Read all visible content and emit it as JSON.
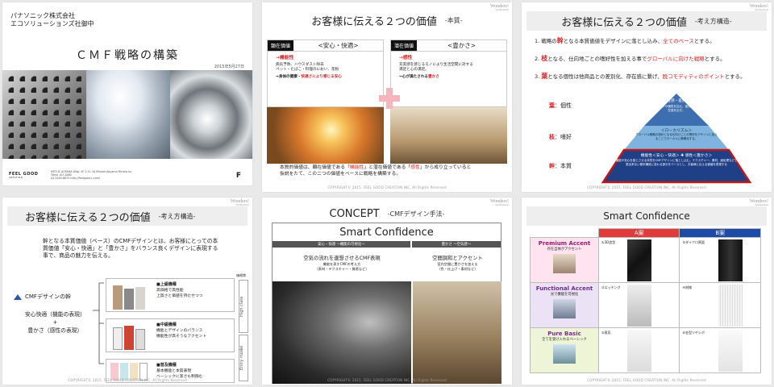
{
  "watermark": {
    "brand": "Wonders!",
    "tagline": "Synthesisnote"
  },
  "footer_copyright": "COPYRIGHT© 2015. FEEL GOOD CREATION INC. All Rights Reserved",
  "slide1": {
    "company": "パナソニック株式会社",
    "division": "エコソリューションズ社御中",
    "title": "ＣＭＦ戦略の構築",
    "date": "2015年5月27日",
    "logo": "FEEL GOOD",
    "logo_sub": "CREATION",
    "address_line1": "METLIS AOYAMA Bldg. 4F 2-11-16 Minami-Aoyama Minato-ku,",
    "address_line2": "Tokyo 107-0062",
    "address_line3": "03-3404-6675 http://feelgood-c.com/",
    "mark": "F"
  },
  "slide2": {
    "title": "お客様に伝える２つの価値",
    "subtitle": "-本質-",
    "left": {
      "tag": "顕在価値",
      "value": "<安心・快適>",
      "head": "→機能性",
      "lines": [
        "病気予防、ハウスダスト除去",
        "ペット・たばこ・料理のにおい、花粉"
      ],
      "result_a": "→身体の健康・",
      "result_b": "快適さにより感じる安心"
    },
    "right": {
      "tag": "潜在価値",
      "value": "<豊かさ>",
      "head": "→感性",
      "lines": [
        "充実感を感じるモノにより生活空間に対する",
        "満足と心の満足。"
      ],
      "result_a": "→心が満たされる",
      "result_b": "豊かさ"
    },
    "body_a": "本質的価値は、顕在価値である「",
    "body_b": "機能性",
    "body_c": "」と潜在価値である「",
    "body_d": "感性",
    "body_e": "」から成り立っていると",
    "body_line2": "仮説をたて、このニつの価値をベースに戦略を構築する。"
  },
  "slide3": {
    "title": "お客様に伝える２つの価値",
    "subtitle": "-考え方構造-",
    "points": [
      {
        "num": "1.",
        "a": "戦略の",
        "k": "幹",
        "b": "となる本質価値をデザインに落とし込み、",
        "c": "全てのベース",
        "d": "とする。"
      },
      {
        "num": "2.",
        "a": "",
        "k": "枝",
        "b": "となる、仕向地ごとの嗜好性を加える事で",
        "c": "グローバルに向けた戦略",
        "d": "とする。"
      },
      {
        "num": "3.",
        "a": "",
        "k": "葉",
        "b": "となる個性は他商品との差別化、存在感に繋げ、",
        "c": "脱コモディティのポイント",
        "d": "とする。"
      }
    ],
    "levels": [
      {
        "k": "葉",
        "label": "：個性",
        "title": "＜存在感・差別化＞",
        "desc": "トレンドや個性を加え、差別化、存在感を出す。"
      },
      {
        "k": "枝",
        "label": "：嗜好",
        "title": "＜ローカリズム＞",
        "desc": "グローバル戦略の指針となる仕向けごとの嗜好をデザインに加えることでローカルに戦略化する。"
      },
      {
        "k": "幹",
        "label": "：本質",
        "title": "機能性＜安心・快適＞ ✚ 感性＜豊かさ＞",
        "desc": "高い機能や安心を感じさせる本質をCMFデザインに落とし込む。テクスチャー、素材、面処理などで、変更出来ない基本構造に変わる部分をベースとし、お客様に伝える価値を表現する"
      }
    ],
    "colors": {
      "leaf": "#3d6fb0",
      "branch": "#7fb4e0",
      "trunk": "#1f3f86",
      "border": "#c01818"
    }
  },
  "slide4": {
    "title": "お客様に伝える２つの価値",
    "subtitle": "-考え方構造-",
    "body": "幹となる本質価値（ベース）のCMFデザインとは、お客様にとっての本質価値「安心・快適」と「豊かさ」をバランス良くデザインに表現する事で、商品の魅力を伝える。",
    "trunk": "CMFデザインの幹",
    "f1": "安心快適（機能の表現）",
    "f2": "+",
    "f3": "豊かさ（感性の表現）",
    "axis_top": "価格帯",
    "side_top": "High class",
    "side_bottom": "Entry model",
    "rows": [
      {
        "head": "■上級機種",
        "l1": "高価格で高性能",
        "l2": "上質さと価値を持たせつつ"
      },
      {
        "head": "■中級機種",
        "l1": "機能とデザインのバランス",
        "l2": "機能性が高そうなアクセント"
      },
      {
        "head": "■普及機種",
        "l1": "基本機能と本質表現",
        "l2": "ベーシックに潔さも制御む"
      }
    ]
  },
  "slide5": {
    "title": "CONCEPT",
    "subtitle": "-CMFデザイン手法-",
    "concept": "Smart Confidence",
    "bar_left": "安心・快適 ～機能の可視化～",
    "bar_right": "豊かさ ～空気感～",
    "left_head": "空気の流れを連想させるCMF表現",
    "left_sub1": "機能を表すCMFの考え方",
    "left_sub2": "（表材・テクスチャー・質感など）",
    "right_head": "空間調和とアクセント",
    "right_sub1": "室内空間に豊かさを加える",
    "right_sub2": "（色・仕上げ・素材など）"
  },
  "slide6": {
    "title": "Smart Confidence",
    "col_a": "A案",
    "col_b": "B案",
    "rows": [
      {
        "name": "Premium Accent",
        "sub": "存在自体がアクセント",
        "a": "①3D造型",
        "b": "②ダイクロ黒面",
        "color": "#a0196e",
        "bg": "#ffe3ef"
      },
      {
        "name": "Functional Accent",
        "sub": "光で機能を可視化",
        "a": "③エッチング",
        "b": "④刻線",
        "color": "#6a2c94",
        "bg": "#ece2f5"
      },
      {
        "name": "Pure Basic",
        "sub": "全てを受け入れるベーシック",
        "a": "⑤蒸気",
        "b": "⑥金型ツヤシボ",
        "color": "#7a2c90",
        "bg": "#eef5d6"
      }
    ],
    "head_a_color": "#e23a3a",
    "head_b_color": "#1d4aa6"
  }
}
